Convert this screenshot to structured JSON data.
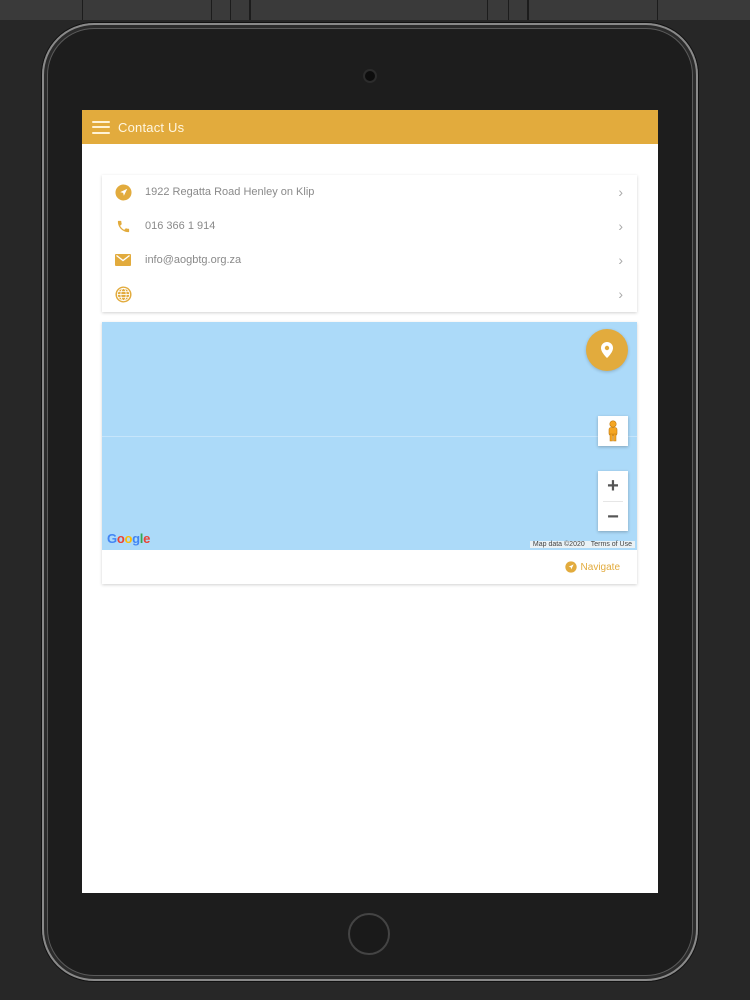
{
  "app": {
    "title": "Contact Us"
  },
  "colors": {
    "accent": "#e2ab3d",
    "map_water": "#acdaf9",
    "device_bg": "#272727"
  },
  "contact": {
    "rows": [
      {
        "icon": "navigation-arrow-icon",
        "text": "1922 Regatta Road Henley on Klip"
      },
      {
        "icon": "phone-icon",
        "text": "016 366 1 914"
      },
      {
        "icon": "email-icon",
        "text": "info@aogbtg.org.za"
      },
      {
        "icon": "globe-icon",
        "text": ""
      }
    ]
  },
  "map": {
    "logo": "Google",
    "attribution": "Map data ©2020",
    "terms": "Terms of Use",
    "zoom_in": "+",
    "zoom_out": "−",
    "navigate_label": "Navigate"
  }
}
